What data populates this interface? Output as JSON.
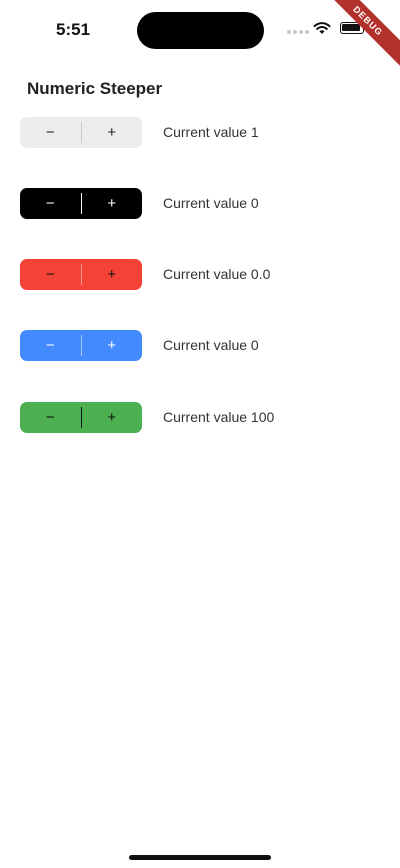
{
  "status_bar": {
    "time": "5:51"
  },
  "debug_banner": "DEBUG",
  "page_title": "Numeric Steeper",
  "steppers": [
    {
      "minus": "−",
      "plus": "+",
      "value_text": "Current value 1",
      "bg": "#ececec",
      "fg": "#222222",
      "divider": "#c9c9c9"
    },
    {
      "minus": "−",
      "plus": "+",
      "value_text": "Current value 0",
      "bg": "#000000",
      "fg": "#ffffff",
      "divider": "#ffffff"
    },
    {
      "minus": "−",
      "plus": "+",
      "value_text": "Current value 0.0",
      "bg": "#f44336",
      "fg": "#111111",
      "divider": "#ff9a93"
    },
    {
      "minus": "−",
      "plus": "+",
      "value_text": "Current value 0",
      "bg": "#448aff",
      "fg": "#ffffff",
      "divider": "#a6c8ff"
    },
    {
      "minus": "−",
      "plus": "+",
      "value_text": "Current value 100",
      "bg": "#4caf50",
      "fg": "#111111",
      "divider": "#111111"
    }
  ]
}
